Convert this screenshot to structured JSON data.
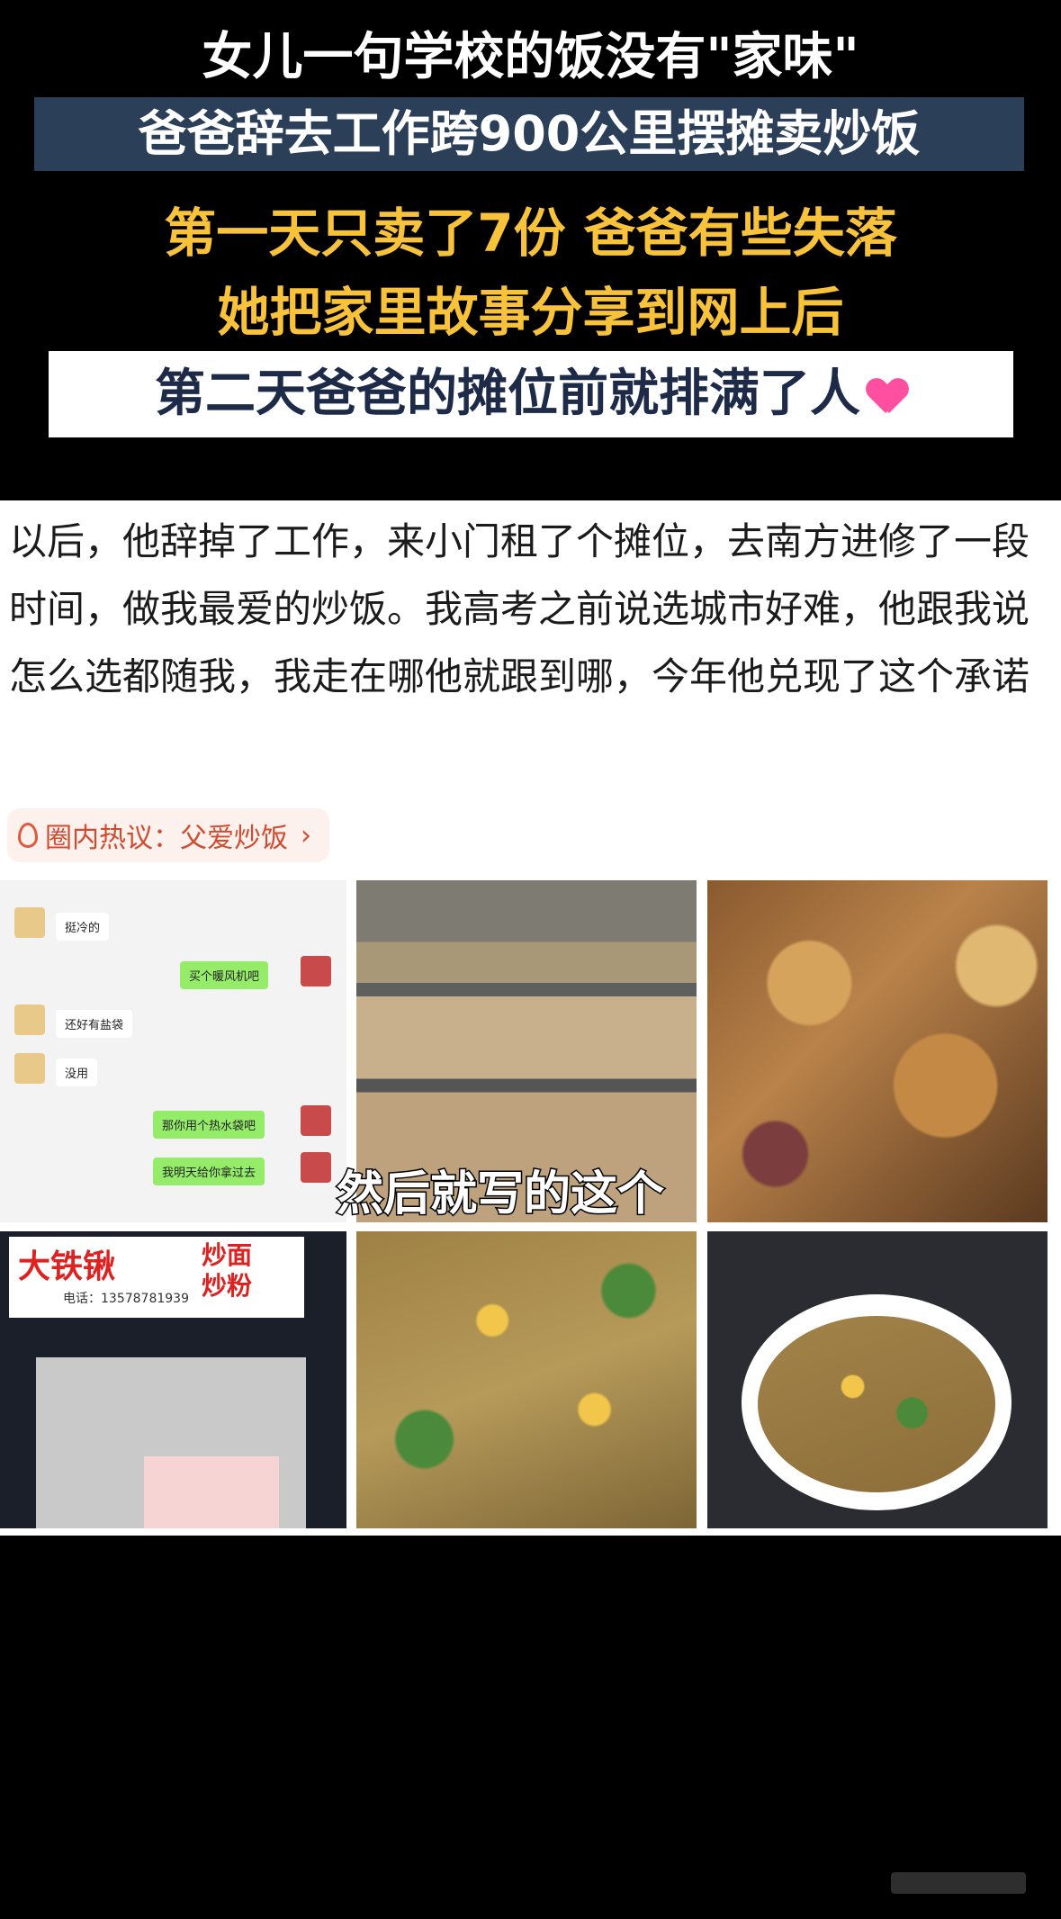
{
  "banner": {
    "line1": "女儿一句学校的饭没有\"家味\"",
    "line2": "爸爸辞去工作跨900公里摆摊卖炒饭",
    "line3": "第一天只卖了7份 爸爸有些失落",
    "line4": "她把家里故事分享到网上后",
    "line5": "第二天爸爸的摊位前就排满了人",
    "heart_color": "#ff4fa0"
  },
  "post": {
    "body": "以后，他辞掉了工作，来小门租了个摊位，去南方进修了一段时间，做我最爱的炒饭。我高考之前说选城市好难，他跟我说怎么选都随我，我走在哪他就跟到哪，今年他兑现了这个承诺",
    "topic_tag": "圈内热议：父爱炒饭",
    "topic_chevron": "›"
  },
  "chat": {
    "messages": [
      {
        "side": "in",
        "text": "挺冷的"
      },
      {
        "side": "out",
        "text": "买个暖风机吧"
      },
      {
        "side": "in",
        "text": "还好有盐袋"
      },
      {
        "side": "in",
        "text": "没用"
      },
      {
        "side": "out",
        "text": "那你用个热水袋吧"
      },
      {
        "side": "out",
        "text": "我明天给你拿过去"
      }
    ]
  },
  "overlay_caption": "然后就写的这个",
  "stall_sign": {
    "name": "大铁锹",
    "sub1": "炒面",
    "sub2": "炒粉",
    "phone": "电话：13578781939"
  }
}
